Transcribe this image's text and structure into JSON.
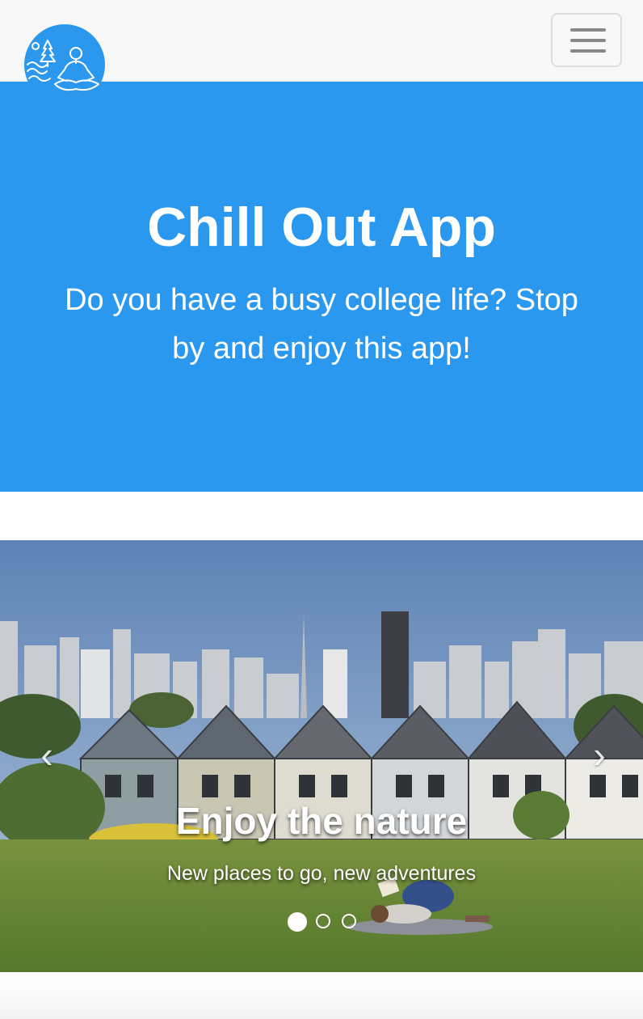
{
  "navbar": {
    "logo": "chill-out-logo",
    "toggle": "hamburger-menu-icon"
  },
  "hero": {
    "title": "Chill Out App",
    "subtitle": "Do you have a busy college life? Stop by and enjoy this app!",
    "background_color": "#2a98ef"
  },
  "carousel": {
    "slides": [
      {
        "title": "Enjoy the nature",
        "subtitle": "New places to go, new adventures",
        "image": "painted-ladies-city-skyline-photo"
      }
    ],
    "active_index": 0,
    "indicator_count": 3,
    "prev_icon": "chevron-left-icon",
    "next_icon": "chevron-right-icon"
  }
}
